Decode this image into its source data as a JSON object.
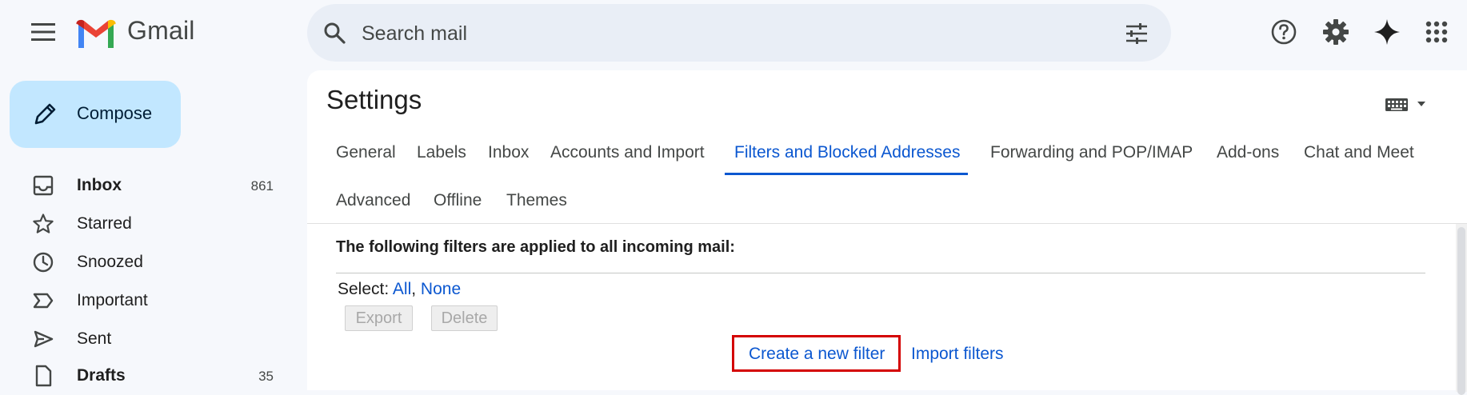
{
  "app": {
    "brand": "Gmail"
  },
  "search": {
    "placeholder": "Search mail"
  },
  "compose": {
    "label": "Compose"
  },
  "sidebar": {
    "items": [
      {
        "label": "Inbox",
        "count": "861",
        "bold": true,
        "icon": "inbox-icon"
      },
      {
        "label": "Starred",
        "count": "",
        "bold": false,
        "icon": "star-icon"
      },
      {
        "label": "Snoozed",
        "count": "",
        "bold": false,
        "icon": "clock-icon"
      },
      {
        "label": "Important",
        "count": "",
        "bold": false,
        "icon": "important-icon"
      },
      {
        "label": "Sent",
        "count": "",
        "bold": false,
        "icon": "send-icon"
      },
      {
        "label": "Drafts",
        "count": "35",
        "bold": true,
        "icon": "draft-icon"
      }
    ]
  },
  "settings": {
    "title": "Settings",
    "tabs": [
      {
        "label": "General"
      },
      {
        "label": "Labels"
      },
      {
        "label": "Inbox"
      },
      {
        "label": "Accounts and Import"
      },
      {
        "label": "Filters and Blocked Addresses",
        "active": true
      },
      {
        "label": "Forwarding and POP/IMAP"
      },
      {
        "label": "Add-ons"
      },
      {
        "label": "Chat and Meet"
      },
      {
        "label": "Advanced"
      },
      {
        "label": "Offline"
      },
      {
        "label": "Themes"
      }
    ]
  },
  "filters": {
    "heading": "The following filters are applied to all incoming mail:",
    "select_label": "Select:",
    "select_all": "All",
    "select_separator": ",",
    "select_none": "None",
    "export_label": "Export",
    "delete_label": "Delete",
    "create_label": "Create a new filter",
    "import_label": "Import filters"
  },
  "colors": {
    "accent": "#0b57d0",
    "compose_bg": "#c2e7ff",
    "highlight_box": "#d40000",
    "page_bg": "#f6f8fc"
  }
}
